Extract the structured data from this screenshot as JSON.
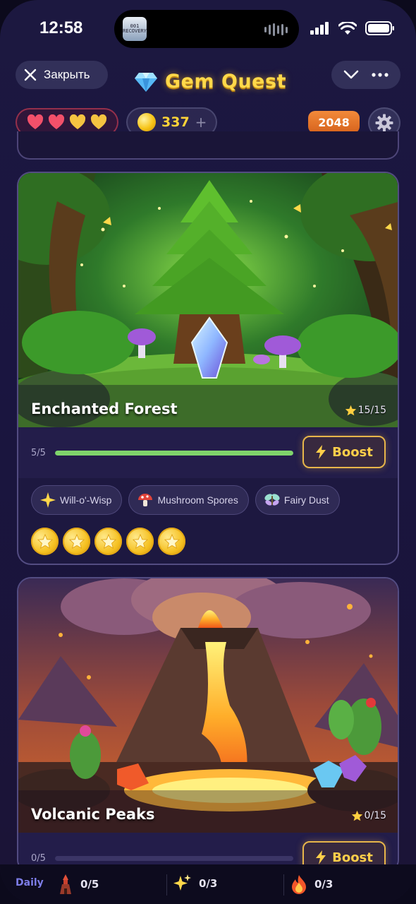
{
  "status_bar": {
    "time": "12:58",
    "island_app_text": "001 RECOVERY",
    "icons": [
      "signal-icon",
      "wifi-icon",
      "battery-icon"
    ]
  },
  "header": {
    "close_label": "Закрыть",
    "title": "Gem Quest",
    "title_icon": "diamond-icon",
    "menu_icons": [
      "chevron-down-icon",
      "more-icon"
    ]
  },
  "stats": {
    "hearts": {
      "filled_red": 2,
      "filled_gold": 2,
      "total": 4
    },
    "coins": "337",
    "coins_add": "+",
    "score": "2048",
    "settings_icon": "gear-icon"
  },
  "worlds": [
    {
      "title": "Enchanted Forest",
      "stars_text": "15/15",
      "progress_text": "5/5",
      "progress_fraction": 1.0,
      "boost_label": "Boost",
      "chips": [
        {
          "icon": "sparkle-icon",
          "label": "Will-o'-Wisp"
        },
        {
          "icon": "mushroom-icon",
          "label": "Mushroom Spores"
        },
        {
          "icon": "fairy-icon",
          "label": "Fairy Dust"
        }
      ],
      "earned_stars": 5
    },
    {
      "title": "Volcanic Peaks",
      "stars_text": "0/15",
      "progress_text": "0/5",
      "progress_fraction": 0.0,
      "boost_label": "Boost"
    }
  ],
  "daily": {
    "label": "Daily",
    "tasks": [
      {
        "icon": "tower-icon",
        "value": "0/5"
      },
      {
        "icon": "sparkles-icon",
        "value": "0/3"
      },
      {
        "icon": "fire-icon",
        "value": "0/3"
      }
    ]
  },
  "colors": {
    "accent_gold": "#ffd94a",
    "progress_green": "#7fd46b",
    "score_orange": "#e8742a",
    "daily_blue": "#7d7de8"
  }
}
